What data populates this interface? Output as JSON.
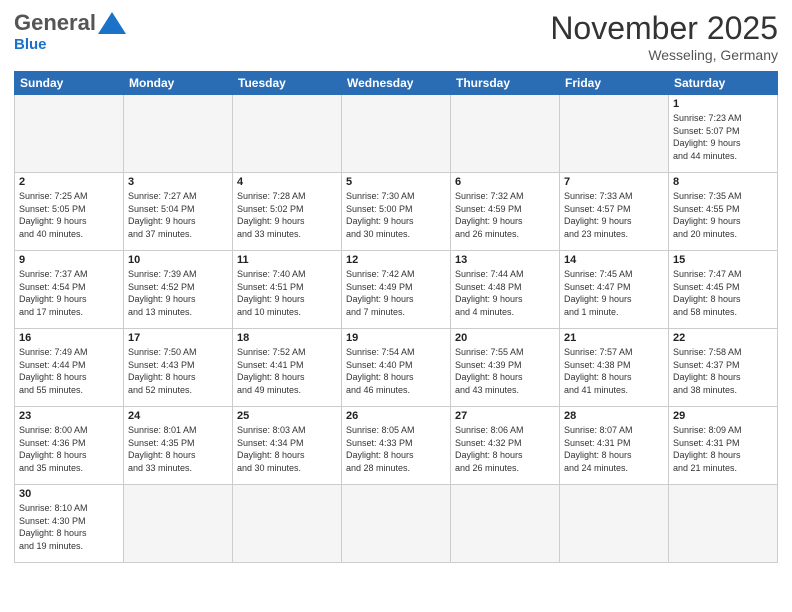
{
  "header": {
    "logo_general": "General",
    "logo_blue": "Blue",
    "month_title": "November 2025",
    "location": "Wesseling, Germany"
  },
  "days_of_week": [
    "Sunday",
    "Monday",
    "Tuesday",
    "Wednesday",
    "Thursday",
    "Friday",
    "Saturday"
  ],
  "weeks": [
    [
      {
        "day": "",
        "info": ""
      },
      {
        "day": "",
        "info": ""
      },
      {
        "day": "",
        "info": ""
      },
      {
        "day": "",
        "info": ""
      },
      {
        "day": "",
        "info": ""
      },
      {
        "day": "",
        "info": ""
      },
      {
        "day": "1",
        "info": "Sunrise: 7:23 AM\nSunset: 5:07 PM\nDaylight: 9 hours\nand 44 minutes."
      }
    ],
    [
      {
        "day": "2",
        "info": "Sunrise: 7:25 AM\nSunset: 5:05 PM\nDaylight: 9 hours\nand 40 minutes."
      },
      {
        "day": "3",
        "info": "Sunrise: 7:27 AM\nSunset: 5:04 PM\nDaylight: 9 hours\nand 37 minutes."
      },
      {
        "day": "4",
        "info": "Sunrise: 7:28 AM\nSunset: 5:02 PM\nDaylight: 9 hours\nand 33 minutes."
      },
      {
        "day": "5",
        "info": "Sunrise: 7:30 AM\nSunset: 5:00 PM\nDaylight: 9 hours\nand 30 minutes."
      },
      {
        "day": "6",
        "info": "Sunrise: 7:32 AM\nSunset: 4:59 PM\nDaylight: 9 hours\nand 26 minutes."
      },
      {
        "day": "7",
        "info": "Sunrise: 7:33 AM\nSunset: 4:57 PM\nDaylight: 9 hours\nand 23 minutes."
      },
      {
        "day": "8",
        "info": "Sunrise: 7:35 AM\nSunset: 4:55 PM\nDaylight: 9 hours\nand 20 minutes."
      }
    ],
    [
      {
        "day": "9",
        "info": "Sunrise: 7:37 AM\nSunset: 4:54 PM\nDaylight: 9 hours\nand 17 minutes."
      },
      {
        "day": "10",
        "info": "Sunrise: 7:39 AM\nSunset: 4:52 PM\nDaylight: 9 hours\nand 13 minutes."
      },
      {
        "day": "11",
        "info": "Sunrise: 7:40 AM\nSunset: 4:51 PM\nDaylight: 9 hours\nand 10 minutes."
      },
      {
        "day": "12",
        "info": "Sunrise: 7:42 AM\nSunset: 4:49 PM\nDaylight: 9 hours\nand 7 minutes."
      },
      {
        "day": "13",
        "info": "Sunrise: 7:44 AM\nSunset: 4:48 PM\nDaylight: 9 hours\nand 4 minutes."
      },
      {
        "day": "14",
        "info": "Sunrise: 7:45 AM\nSunset: 4:47 PM\nDaylight: 9 hours\nand 1 minute."
      },
      {
        "day": "15",
        "info": "Sunrise: 7:47 AM\nSunset: 4:45 PM\nDaylight: 8 hours\nand 58 minutes."
      }
    ],
    [
      {
        "day": "16",
        "info": "Sunrise: 7:49 AM\nSunset: 4:44 PM\nDaylight: 8 hours\nand 55 minutes."
      },
      {
        "day": "17",
        "info": "Sunrise: 7:50 AM\nSunset: 4:43 PM\nDaylight: 8 hours\nand 52 minutes."
      },
      {
        "day": "18",
        "info": "Sunrise: 7:52 AM\nSunset: 4:41 PM\nDaylight: 8 hours\nand 49 minutes."
      },
      {
        "day": "19",
        "info": "Sunrise: 7:54 AM\nSunset: 4:40 PM\nDaylight: 8 hours\nand 46 minutes."
      },
      {
        "day": "20",
        "info": "Sunrise: 7:55 AM\nSunset: 4:39 PM\nDaylight: 8 hours\nand 43 minutes."
      },
      {
        "day": "21",
        "info": "Sunrise: 7:57 AM\nSunset: 4:38 PM\nDaylight: 8 hours\nand 41 minutes."
      },
      {
        "day": "22",
        "info": "Sunrise: 7:58 AM\nSunset: 4:37 PM\nDaylight: 8 hours\nand 38 minutes."
      }
    ],
    [
      {
        "day": "23",
        "info": "Sunrise: 8:00 AM\nSunset: 4:36 PM\nDaylight: 8 hours\nand 35 minutes."
      },
      {
        "day": "24",
        "info": "Sunrise: 8:01 AM\nSunset: 4:35 PM\nDaylight: 8 hours\nand 33 minutes."
      },
      {
        "day": "25",
        "info": "Sunrise: 8:03 AM\nSunset: 4:34 PM\nDaylight: 8 hours\nand 30 minutes."
      },
      {
        "day": "26",
        "info": "Sunrise: 8:05 AM\nSunset: 4:33 PM\nDaylight: 8 hours\nand 28 minutes."
      },
      {
        "day": "27",
        "info": "Sunrise: 8:06 AM\nSunset: 4:32 PM\nDaylight: 8 hours\nand 26 minutes."
      },
      {
        "day": "28",
        "info": "Sunrise: 8:07 AM\nSunset: 4:31 PM\nDaylight: 8 hours\nand 24 minutes."
      },
      {
        "day": "29",
        "info": "Sunrise: 8:09 AM\nSunset: 4:31 PM\nDaylight: 8 hours\nand 21 minutes."
      }
    ],
    [
      {
        "day": "30",
        "info": "Sunrise: 8:10 AM\nSunset: 4:30 PM\nDaylight: 8 hours\nand 19 minutes."
      },
      {
        "day": "",
        "info": ""
      },
      {
        "day": "",
        "info": ""
      },
      {
        "day": "",
        "info": ""
      },
      {
        "day": "",
        "info": ""
      },
      {
        "day": "",
        "info": ""
      },
      {
        "day": "",
        "info": ""
      }
    ]
  ]
}
